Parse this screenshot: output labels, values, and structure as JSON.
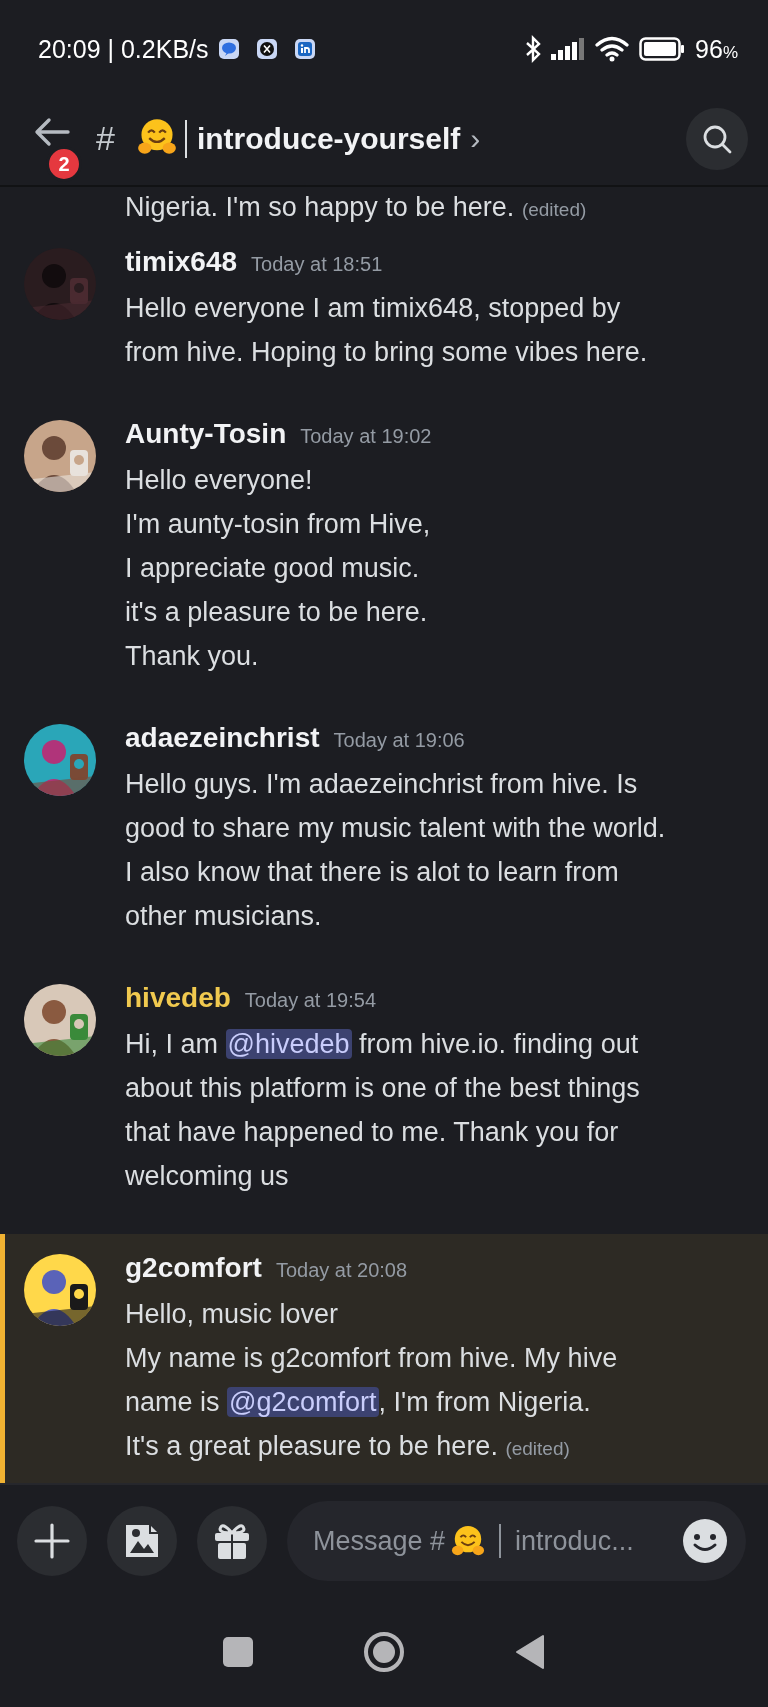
{
  "status_bar": {
    "time": "20:09",
    "separator": "|",
    "speed": "0.2KB/s",
    "battery": "96",
    "battery_unit": "%"
  },
  "header": {
    "badge": "2",
    "hash": "#",
    "title": "introduce-yourself",
    "chevron": "›"
  },
  "previous_message_tail": [
    {
      "text": "Nigeria. I'm so happy to be here. ",
      "kind": "text"
    },
    {
      "text": "(edited)",
      "kind": "edited"
    }
  ],
  "messages": [
    {
      "author": "timix648",
      "color": "#f2f3f5",
      "time": "Today at 18:51",
      "highlighted": false,
      "lines": [
        [
          {
            "text": "Hello everyone I am timix648, stopped by",
            "kind": "text"
          }
        ],
        [
          {
            "text": "from hive. Hoping to bring some vibes here.",
            "kind": "text"
          }
        ]
      ]
    },
    {
      "author": "Aunty-Tosin",
      "color": "#f2f3f5",
      "time": "Today at 19:02",
      "highlighted": false,
      "lines": [
        [
          {
            "text": "Hello everyone!",
            "kind": "text"
          }
        ],
        [
          {
            "text": "I'm aunty-tosin from Hive,",
            "kind": "text"
          }
        ],
        [
          {
            "text": "I appreciate good music.",
            "kind": "text"
          }
        ],
        [
          {
            "text": "it's a pleasure to be here.",
            "kind": "text"
          }
        ],
        [
          {
            "text": "Thank you.",
            "kind": "text"
          }
        ]
      ]
    },
    {
      "author": "adaezeinchrist",
      "color": "#f2f3f5",
      "time": "Today at 19:06",
      "highlighted": false,
      "lines": [
        [
          {
            "text": "Hello guys. I'm adaezeinchrist from hive. Is",
            "kind": "text"
          }
        ],
        [
          {
            "text": "good to share my music talent with the world.",
            "kind": "text"
          }
        ],
        [
          {
            "text": "I also know that there is alot to learn from",
            "kind": "text"
          }
        ],
        [
          {
            "text": "other musicians.",
            "kind": "text"
          }
        ]
      ]
    },
    {
      "author": "hivedeb",
      "color": "#f0c94f",
      "time": "Today at 19:54",
      "highlighted": false,
      "lines": [
        [
          {
            "text": "Hi, I am ",
            "kind": "text"
          },
          {
            "text": "@hivedeb",
            "kind": "mention"
          },
          {
            "text": " from hive.io. finding out",
            "kind": "text"
          }
        ],
        [
          {
            "text": "about this platform is one of the best things",
            "kind": "text"
          }
        ],
        [
          {
            "text": "that have happened to me. Thank you for",
            "kind": "text"
          }
        ],
        [
          {
            "text": "welcoming us",
            "kind": "text"
          }
        ]
      ]
    },
    {
      "author": "g2comfort",
      "color": "#f2f3f5",
      "time": "Today at 20:08",
      "highlighted": true,
      "lines": [
        [
          {
            "text": "Hello, music lover",
            "kind": "text"
          }
        ],
        [
          {
            "text": "My name is g2comfort from hive. My hive",
            "kind": "text"
          }
        ],
        [
          {
            "text": "name is ",
            "kind": "text"
          },
          {
            "text": "@g2comfort",
            "kind": "mention"
          },
          {
            "text": ", I'm from Nigeria.",
            "kind": "text"
          }
        ],
        [
          {
            "text": "It's a great pleasure to be here. ",
            "kind": "text"
          },
          {
            "text": "(edited)",
            "kind": "edited"
          }
        ]
      ]
    }
  ],
  "composer": {
    "placeholder_prefix": "Message #",
    "placeholder_suffix": "introduc..."
  }
}
